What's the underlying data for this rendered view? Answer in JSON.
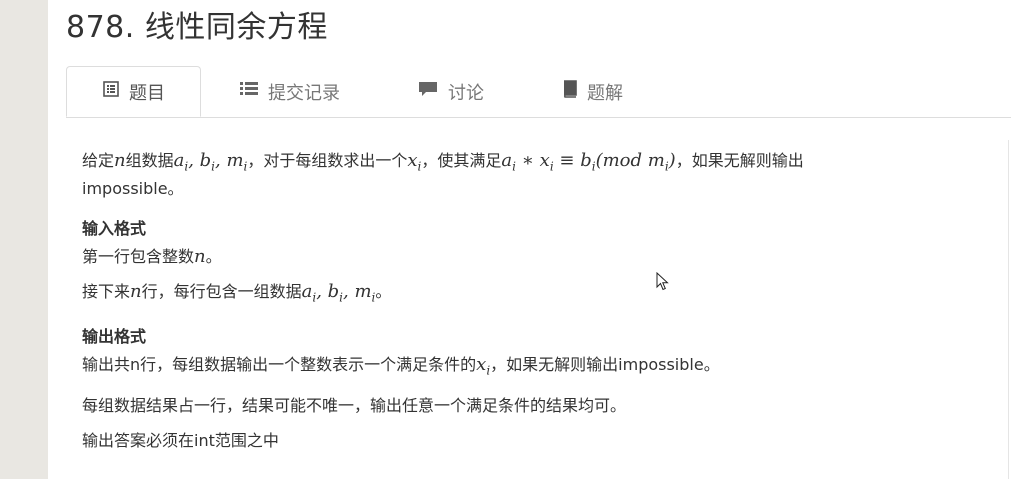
{
  "problem": {
    "title": "878. 线性同余方程"
  },
  "tabs": [
    {
      "label": "题目",
      "icon": "list-alt-icon",
      "active": true
    },
    {
      "label": "提交记录",
      "icon": "list-icon",
      "active": false
    },
    {
      "label": "讨论",
      "icon": "comment-icon",
      "active": false
    },
    {
      "label": "题解",
      "icon": "book-icon",
      "active": false
    }
  ],
  "statement": {
    "intro_a": "给定",
    "intro_b": "组数据",
    "intro_c": "，对于每组数求出一个",
    "intro_d": "，使其满足",
    "intro_e": "，如果无解则输出",
    "intro_line2": "impossible。",
    "input_heading": "输入格式",
    "input_line1_a": "第一行包含整数",
    "input_line1_b": "。",
    "input_line2_a": "接下来",
    "input_line2_b": "行，每行包含一组数据",
    "input_line2_c": "。",
    "output_heading": "输出格式",
    "output_line1_a": "输出共n行，每组数据输出一个整数表示一个满足条件的",
    "output_line1_b": "，如果无解则输出impossible。",
    "output_line2": "每组数据结果占一行，结果可能不唯一，输出任意一个满足条件的结果均可。",
    "output_line3_partial": "输出答案必须在int范围之中"
  },
  "math": {
    "n": "n",
    "abm": "a, b, m",
    "xi": "x",
    "i": "i",
    "equation": "a * x ≡ b(mod m)"
  }
}
